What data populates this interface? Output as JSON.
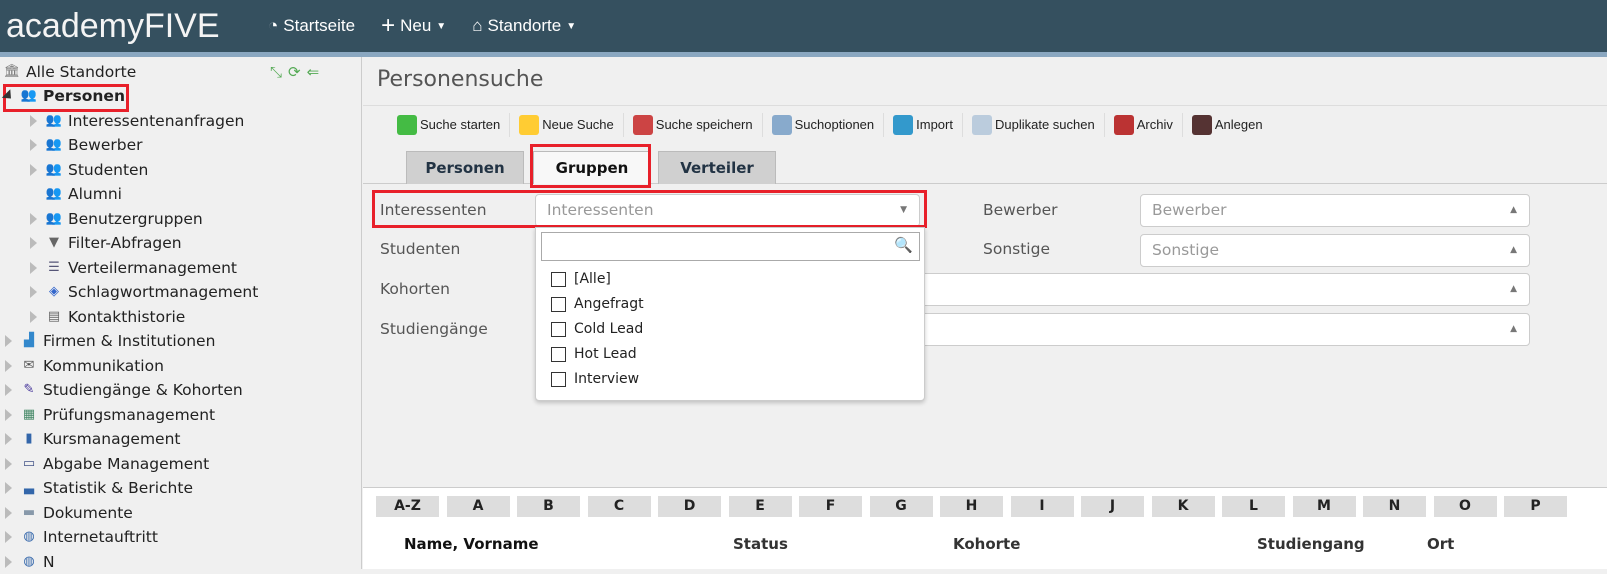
{
  "header": {
    "logo": "academyFIVE",
    "nav": [
      {
        "label": "Startseite",
        "icon": "dashboard-icon"
      },
      {
        "label": "Neu",
        "icon": "plus-icon"
      },
      {
        "label": "Standorte",
        "icon": "home-icon"
      }
    ]
  },
  "sidebar": {
    "root": "Alle Standorte",
    "items": [
      {
        "label": "Personen",
        "level": 0,
        "expanded": true,
        "bold": true,
        "icon": "persons-icon"
      },
      {
        "label": "Interessentenanfragen",
        "level": 1,
        "icon": "persons-icon"
      },
      {
        "label": "Bewerber",
        "level": 1,
        "icon": "persons-icon"
      },
      {
        "label": "Studenten",
        "level": 1,
        "icon": "persons-icon"
      },
      {
        "label": "Alumni",
        "level": 1,
        "noarrow": true,
        "icon": "persons-icon"
      },
      {
        "label": "Benutzergruppen",
        "level": 1,
        "icon": "persons-icon"
      },
      {
        "label": "Filter-Abfragen",
        "level": 1,
        "icon": "filter-icon"
      },
      {
        "label": "Verteilermanagement",
        "level": 1,
        "icon": "list-icon"
      },
      {
        "label": "Schlagwortmanagement",
        "level": 1,
        "icon": "tag-icon"
      },
      {
        "label": "Kontakthistorie",
        "level": 1,
        "icon": "history-icon"
      },
      {
        "label": "Firmen & Institutionen",
        "level": 0,
        "icon": "factory-icon"
      },
      {
        "label": "Kommunikation",
        "level": 0,
        "icon": "envelope-icon"
      },
      {
        "label": "Studiengänge & Kohorten",
        "level": 0,
        "icon": "graduation-icon"
      },
      {
        "label": "Prüfungsmanagement",
        "level": 0,
        "icon": "exam-icon"
      },
      {
        "label": "Kursmanagement",
        "level": 0,
        "icon": "book-icon"
      },
      {
        "label": "Abgabe Management",
        "level": 0,
        "icon": "id-card-icon"
      },
      {
        "label": "Statistik & Berichte",
        "level": 0,
        "icon": "bar-chart-icon"
      },
      {
        "label": "Dokumente",
        "level": 0,
        "icon": "folder-icon"
      },
      {
        "label": "Internetauftritt",
        "level": 0,
        "icon": "globe-icon"
      },
      {
        "label": "N",
        "level": 0,
        "icon": "globe-icon"
      }
    ]
  },
  "main": {
    "title": "Personensuche",
    "toolbar": [
      "Suche starten",
      "Neue Suche",
      "Suche speichern",
      "Suchoptionen",
      "Import",
      "Duplikate suchen",
      "Archiv",
      "Anlegen"
    ],
    "tabs": [
      "Personen",
      "Gruppen",
      "Verteiler"
    ],
    "active_tab": "Gruppen",
    "fields": {
      "interessenten": {
        "label": "Interessenten",
        "placeholder": "Interessenten"
      },
      "studenten": {
        "label": "Studenten"
      },
      "kohorten": {
        "label": "Kohorten"
      },
      "studiengaenge": {
        "label": "Studiengänge"
      },
      "bewerber": {
        "label": "Bewerber",
        "placeholder": "Bewerber"
      },
      "sonstige": {
        "label": "Sonstige",
        "placeholder": "Sonstige"
      }
    },
    "dropdown": {
      "search": "",
      "options": [
        "[Alle]",
        "Angefragt",
        "Cold Lead",
        "Hot Lead",
        "Interview"
      ]
    },
    "letters": [
      "A-Z",
      "A",
      "B",
      "C",
      "D",
      "E",
      "F",
      "G",
      "H",
      "I",
      "J",
      "K",
      "L",
      "M",
      "N",
      "O",
      "P"
    ],
    "columns": [
      "Name, Vorname",
      "Status",
      "Kohorte",
      "Studiengang",
      "Ort"
    ]
  },
  "colors": {
    "header": "#35505f",
    "highlight": "#e8202a"
  }
}
